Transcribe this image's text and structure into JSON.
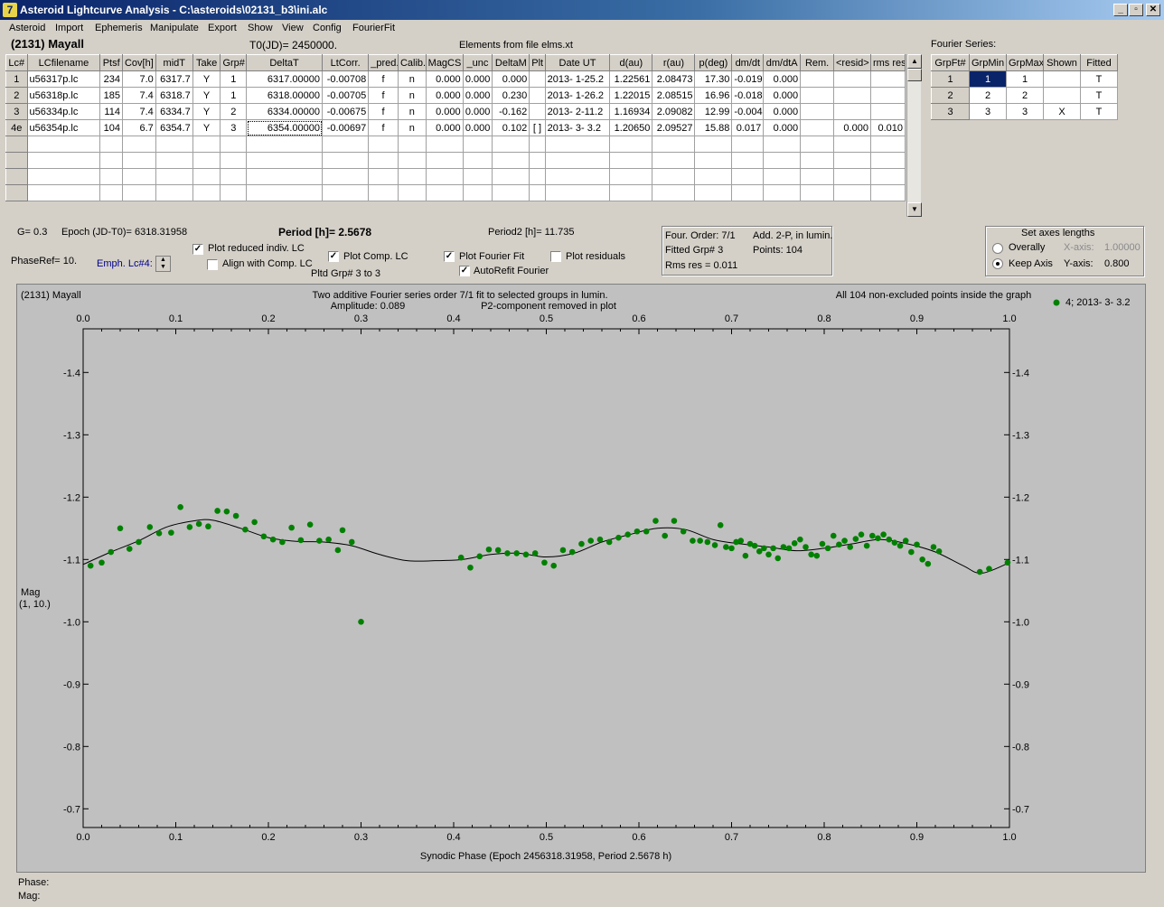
{
  "window": {
    "title": "Asteroid Lightcurve Analysis - C:\\asteroids\\02131_b3\\ini.alc",
    "icon": "app-icon",
    "minimize": "_",
    "restore": "▫",
    "close": "✕"
  },
  "menu": [
    "Asteroid",
    "Import",
    "Ephemeris",
    "Manipulate",
    "Export",
    "Show",
    "View",
    "Config",
    "FourierFit"
  ],
  "header": {
    "asteroid": "(2131) Mayall",
    "t0": "T0(JD)= 2450000.",
    "elements": "Elements from file elms.xt",
    "fourier_title": "Fourier Series:"
  },
  "lc_table": {
    "columns": [
      "Lc#",
      "LCfilename",
      "Ptsf",
      "Cov[h]",
      "midT",
      "Take",
      "Grp#",
      "DeltaT",
      "LtCorr.",
      "_pred.",
      "Calib.",
      "MagCS",
      "_unc",
      "DeltaM",
      "Plt",
      "Date UT",
      "d(au)",
      "r(au)",
      "p(deg)",
      "dm/dt",
      "dm/dtA",
      "Rem.",
      "<resid>",
      "rms res"
    ],
    "rows": [
      [
        "1",
        "u56317p.lc",
        "234",
        "7.0",
        "6317.7",
        "Y",
        "1",
        "6317.00000",
        "-0.00708",
        "f",
        "n",
        "0.000",
        "0.000",
        "0.000",
        "",
        "2013- 1-25.2",
        "1.22561",
        "2.08473",
        "17.30",
        "-0.019",
        "0.000",
        "",
        "",
        ""
      ],
      [
        "2",
        "u56318p.lc",
        "185",
        "7.4",
        "6318.7",
        "Y",
        "1",
        "6318.00000",
        "-0.00705",
        "f",
        "n",
        "0.000",
        "0.000",
        "0.230",
        "",
        "2013- 1-26.2",
        "1.22015",
        "2.08515",
        "16.96",
        "-0.018",
        "0.000",
        "",
        "",
        ""
      ],
      [
        "3",
        "u56334p.lc",
        "114",
        "7.4",
        "6334.7",
        "Y",
        "2",
        "6334.00000",
        "-0.00675",
        "f",
        "n",
        "0.000",
        "0.000",
        "-0.162",
        "",
        "2013- 2-11.2",
        "1.16934",
        "2.09082",
        "12.99",
        "-0.004",
        "0.000",
        "",
        "",
        ""
      ],
      [
        "4e",
        "u56354p.lc",
        "104",
        "6.7",
        "6354.7",
        "Y",
        "3",
        "6354.00000",
        "-0.00697",
        "f",
        "n",
        "0.000",
        "0.000",
        "0.102",
        "[ ]",
        "2013- 3- 3.2",
        "1.20650",
        "2.09527",
        "15.88",
        "0.017",
        "0.000",
        "",
        "0.000",
        "0.010"
      ]
    ],
    "empty_rows": 4
  },
  "fourier_table": {
    "columns": [
      "GrpFt#",
      "GrpMin",
      "GrpMax",
      "Shown",
      "Fitted"
    ],
    "rows": [
      [
        "1",
        "1",
        "1",
        "",
        "T"
      ],
      [
        "2",
        "2",
        "2",
        "",
        "T"
      ],
      [
        "3",
        "3",
        "3",
        "X",
        "T"
      ]
    ]
  },
  "controls": {
    "g": "G= 0.3",
    "epoch": "Epoch (JD-T0)= 6318.31958",
    "period": "Period [h]= 2.5678",
    "period2": "Period2 [h]= 11.735",
    "phaseref": "PhaseRef= 10.",
    "emph": "Emph. Lc#4:",
    "plot_reduced": {
      "label": "Plot reduced indiv. LC",
      "checked": true
    },
    "align_comp": {
      "label": "Align with Comp. LC",
      "checked": false
    },
    "plot_comp": {
      "label": "Plot Comp. LC",
      "checked": true
    },
    "pltd_grp": "Pltd Grp#  3   to   3",
    "plot_fourier": {
      "label": "Plot Fourier Fit",
      "checked": true
    },
    "autorefit": {
      "label": "AutoRefit Fourier",
      "checked": true
    },
    "plot_residuals": {
      "label": "Plot residuals",
      "checked": false
    }
  },
  "fit_info": {
    "order": "Four. Order:  7/1",
    "mode": "Add. 2-P, in lumin.",
    "grp": "Fitted Grp# 3",
    "points": "Points: 104",
    "rms": "Rms res     = 0.011"
  },
  "axes_box": {
    "title": "Set axes lengths",
    "overally": "Overally",
    "keep_axis": "Keep Axis",
    "x_label": "X-axis:",
    "x_value": "1.00000",
    "y_label": "Y-axis:",
    "y_value": "0.800"
  },
  "plot": {
    "name": "(2131) Mayall",
    "line1": "Two additive Fourier series order 7/1 fit to selected groups in lumin.",
    "amplitude": "Amplitude: 0.089",
    "p2note": "P2-component removed in plot",
    "right_note": "All 104 non-excluded points inside the graph",
    "legend": "4; 2013- 3- 3.2",
    "ylabel1": "Mag",
    "ylabel2": "(1, 10.)",
    "xlabel": "Synodic Phase (Epoch 2456318.31958, Period 2.5678 h)",
    "point_color": "#008000"
  },
  "status": {
    "phase": "Phase:",
    "mag": "Mag:"
  },
  "chart_data": {
    "type": "scatter",
    "xlim": [
      0.0,
      1.0
    ],
    "ylim": [
      -1.47,
      -0.67
    ],
    "y_inverted": true,
    "x_ticks": [
      "0.0",
      "0.1",
      "0.2",
      "0.3",
      "0.4",
      "0.5",
      "0.6",
      "0.7",
      "0.8",
      "0.9",
      "1.0"
    ],
    "y_ticks": [
      "-1.4",
      "-1.3",
      "-1.2",
      "-1.1",
      "-1.0",
      "-0.9",
      "-0.8",
      "-0.7"
    ],
    "series": [
      {
        "name": "4; 2013- 3- 3.2",
        "x": [
          0.008,
          0.02,
          0.03,
          0.04,
          0.05,
          0.06,
          0.072,
          0.082,
          0.095,
          0.105,
          0.115,
          0.125,
          0.135,
          0.145,
          0.155,
          0.165,
          0.175,
          0.185,
          0.195,
          0.205,
          0.215,
          0.225,
          0.235,
          0.245,
          0.255,
          0.265,
          0.275,
          0.28,
          0.29,
          0.3,
          0.408,
          0.418,
          0.428,
          0.438,
          0.448,
          0.458,
          0.468,
          0.478,
          0.488,
          0.498,
          0.508,
          0.518,
          0.528,
          0.538,
          0.548,
          0.558,
          0.568,
          0.578,
          0.588,
          0.598,
          0.608,
          0.618,
          0.628,
          0.638,
          0.648,
          0.658,
          0.666,
          0.674,
          0.682,
          0.688,
          0.694,
          0.7,
          0.705,
          0.71,
          0.715,
          0.72,
          0.725,
          0.73,
          0.735,
          0.74,
          0.745,
          0.75,
          0.756,
          0.762,
          0.768,
          0.774,
          0.78,
          0.786,
          0.792,
          0.798,
          0.804,
          0.81,
          0.816,
          0.822,
          0.828,
          0.834,
          0.84,
          0.846,
          0.852,
          0.858,
          0.864,
          0.87,
          0.876,
          0.882,
          0.888,
          0.894,
          0.9,
          0.906,
          0.912,
          0.918,
          0.924,
          0.968,
          0.978,
          0.998
        ],
        "y": [
          -1.09,
          -1.095,
          -1.112,
          -1.15,
          -1.117,
          -1.128,
          -1.152,
          -1.142,
          -1.143,
          -1.184,
          -1.152,
          -1.157,
          -1.153,
          -1.178,
          -1.177,
          -1.17,
          -1.148,
          -1.16,
          -1.137,
          -1.132,
          -1.128,
          -1.151,
          -1.131,
          -1.156,
          -1.13,
          -1.132,
          -1.115,
          -1.147,
          -1.128,
          -1.0,
          -1.103,
          -1.087,
          -1.105,
          -1.116,
          -1.115,
          -1.11,
          -1.11,
          -1.108,
          -1.11,
          -1.095,
          -1.09,
          -1.115,
          -1.112,
          -1.125,
          -1.13,
          -1.132,
          -1.128,
          -1.135,
          -1.14,
          -1.145,
          -1.145,
          -1.162,
          -1.138,
          -1.162,
          -1.145,
          -1.13,
          -1.13,
          -1.128,
          -1.123,
          -1.155,
          -1.12,
          -1.118,
          -1.128,
          -1.13,
          -1.106,
          -1.125,
          -1.122,
          -1.113,
          -1.118,
          -1.108,
          -1.118,
          -1.102,
          -1.12,
          -1.118,
          -1.126,
          -1.132,
          -1.12,
          -1.108,
          -1.106,
          -1.125,
          -1.118,
          -1.138,
          -1.124,
          -1.13,
          -1.12,
          -1.133,
          -1.14,
          -1.122,
          -1.138,
          -1.134,
          -1.14,
          -1.132,
          -1.127,
          -1.122,
          -1.13,
          -1.112,
          -1.124,
          -1.1,
          -1.093,
          -1.12,
          -1.113,
          -1.08,
          -1.085,
          -1.095
        ]
      }
    ],
    "fit_curve": {
      "x": [
        0.0,
        0.03,
        0.06,
        0.09,
        0.12,
        0.14,
        0.17,
        0.2,
        0.23,
        0.26,
        0.29,
        0.32,
        0.35,
        0.38,
        0.41,
        0.44,
        0.47,
        0.5,
        0.53,
        0.56,
        0.59,
        0.62,
        0.65,
        0.68,
        0.71,
        0.74,
        0.77,
        0.8,
        0.83,
        0.86,
        0.89,
        0.92,
        0.95,
        0.97,
        1.0
      ],
      "y": [
        -1.092,
        -1.112,
        -1.13,
        -1.152,
        -1.162,
        -1.163,
        -1.15,
        -1.135,
        -1.129,
        -1.128,
        -1.122,
        -1.108,
        -1.098,
        -1.098,
        -1.1,
        -1.108,
        -1.11,
        -1.104,
        -1.11,
        -1.128,
        -1.14,
        -1.15,
        -1.148,
        -1.132,
        -1.125,
        -1.12,
        -1.114,
        -1.118,
        -1.125,
        -1.132,
        -1.125,
        -1.112,
        -1.09,
        -1.078,
        -1.095
      ]
    }
  }
}
